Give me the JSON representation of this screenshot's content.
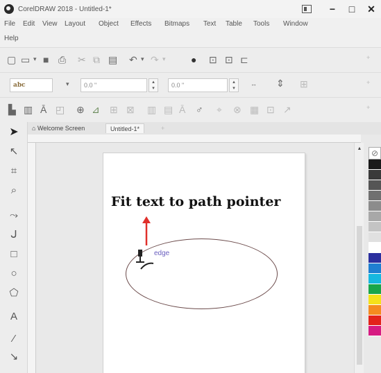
{
  "window": {
    "title": "CorelDRAW 2018 - Untitled-1*"
  },
  "menu": [
    "File",
    "Edit",
    "View",
    "Layout",
    "Object",
    "Effects",
    "Bitmaps",
    "Text",
    "Table",
    "Tools",
    "Window",
    "Help"
  ],
  "property_bar": {
    "font_style": "abc",
    "offset_label": "0.0 \"",
    "distance_label": "0.0 \""
  },
  "tabs": {
    "welcome": "Welcome Screen",
    "doc": "Untitled-1*"
  },
  "canvas": {
    "path_label": "edge"
  },
  "annotation": {
    "text": "Fit text to path pointer",
    "color": "#111111",
    "arrow_color": "#e0302b"
  },
  "palette_colors": [
    "#1a1a1a",
    "#3a3a3a",
    "#555555",
    "#707070",
    "#8c8c8c",
    "#a8a8a8",
    "#c4c4c4",
    "#e0e0e0",
    "#ffffff",
    "#2b2f9e",
    "#1f7fd1",
    "#16b8e0",
    "#19a64a",
    "#f5e11a",
    "#f58a1f",
    "#e3221b",
    "#d61b82"
  ]
}
